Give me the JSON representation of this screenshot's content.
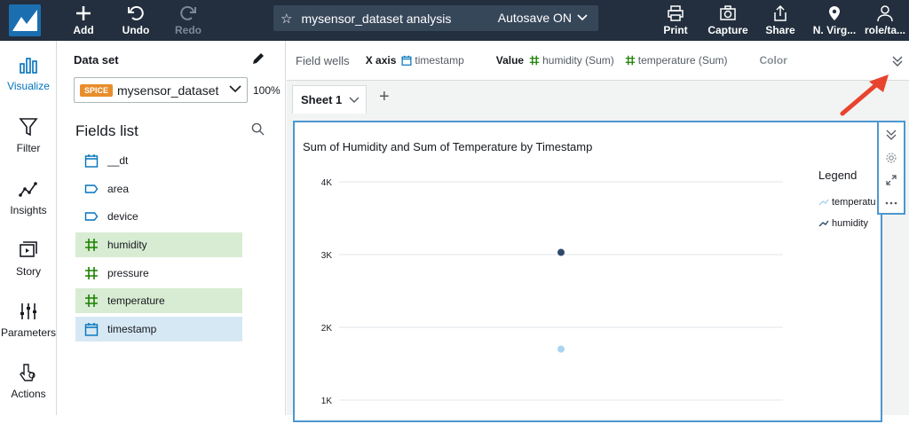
{
  "toolbar": {
    "add": "Add",
    "undo": "Undo",
    "redo": "Redo",
    "analysis_name": "mysensor_dataset analysis",
    "autosave": "Autosave ON",
    "print": "Print",
    "capture": "Capture",
    "share": "Share",
    "region": "N. Virg...",
    "user": "role/ta..."
  },
  "nav": {
    "visualize": "Visualize",
    "filter": "Filter",
    "insights": "Insights",
    "story": "Story",
    "parameters": "Parameters",
    "actions": "Actions"
  },
  "dataset": {
    "label": "Data set",
    "badge": "SPICE",
    "name": "mysensor_dataset",
    "percent": "100%"
  },
  "fields": {
    "title": "Fields list",
    "items": [
      {
        "label": "__dt",
        "kind": "date"
      },
      {
        "label": "area",
        "kind": "dimension"
      },
      {
        "label": "device",
        "kind": "dimension"
      },
      {
        "label": "humidity",
        "kind": "measure"
      },
      {
        "label": "pressure",
        "kind": "measure"
      },
      {
        "label": "temperature",
        "kind": "measure"
      },
      {
        "label": "timestamp",
        "kind": "date"
      }
    ]
  },
  "wells": {
    "label": "Field wells",
    "xaxis_key": "X axis",
    "xaxis_val": "timestamp",
    "value_key": "Value",
    "value_1": "humidity (Sum)",
    "value_2": "temperature (Sum)",
    "color": "Color"
  },
  "sheet": {
    "tab": "Sheet 1"
  },
  "colors": {
    "humidity": "#2d4a6b",
    "temperature": "#a8d5ef",
    "accent": "#0073bb",
    "selection": "#4c97d1"
  },
  "chart_data": {
    "type": "line",
    "title": "Sum of Humidity and Sum of Temperature by Timestamp",
    "yticks": [
      "1K",
      "2K",
      "3K",
      "4K"
    ],
    "ylim": [
      1000,
      4000
    ],
    "grid": true,
    "legend": {
      "title": "Legend",
      "placement": "right"
    },
    "series": [
      {
        "name": "temperature",
        "values": [
          1700
        ]
      },
      {
        "name": "humidity",
        "values": [
          3030
        ]
      }
    ],
    "legend_labels": [
      "temperatu",
      "humidity"
    ]
  }
}
